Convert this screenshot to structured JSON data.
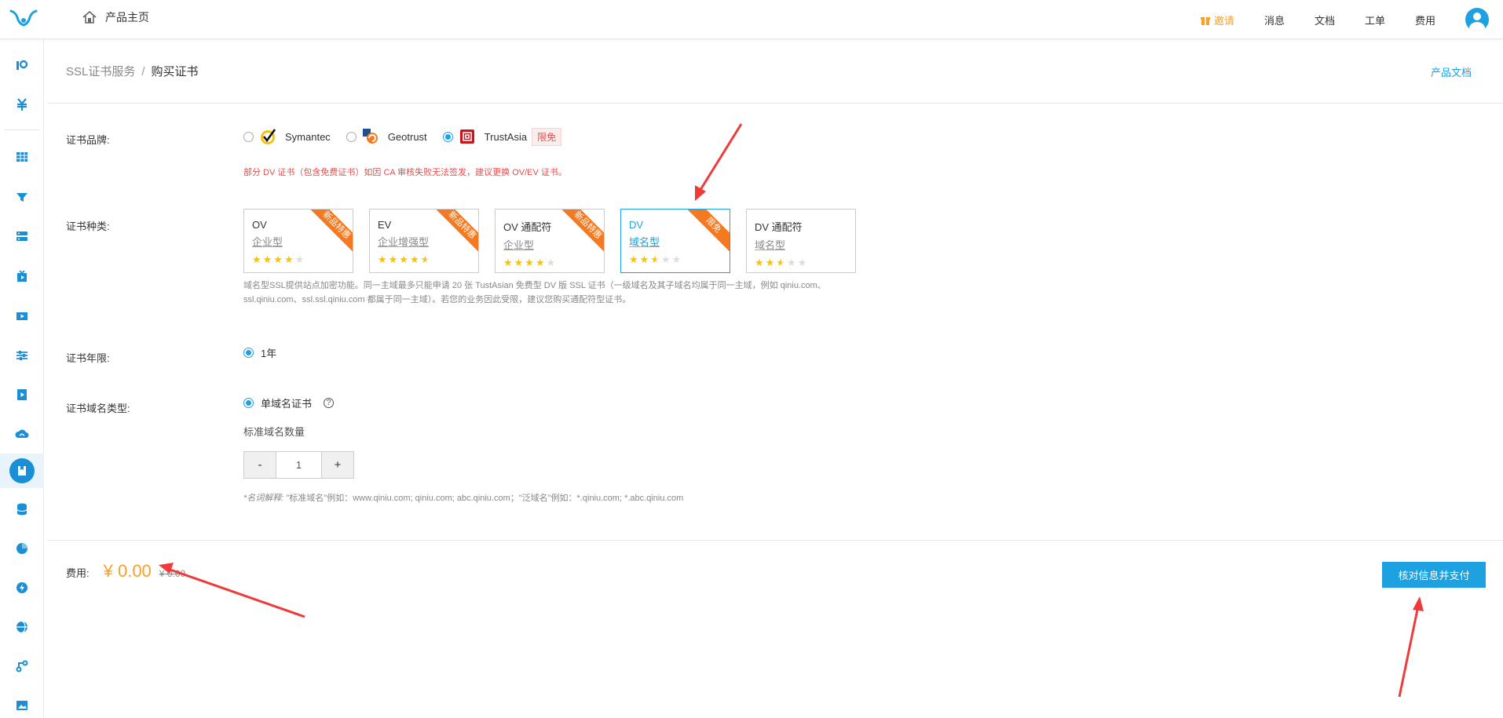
{
  "topbar": {
    "home_label": "产品主页",
    "invite": "邀请",
    "messages": "消息",
    "docs": "文档",
    "tickets": "工单",
    "billing": "费用"
  },
  "breadcrumb": {
    "service": "SSL证书服务",
    "separator": "/",
    "current": "购买证书"
  },
  "product_docs": "产品文档",
  "brand": {
    "label": "证书品牌:",
    "options": [
      {
        "name": "Symantec",
        "selected": false
      },
      {
        "name": "Geotrust",
        "selected": false
      },
      {
        "name": "TrustAsia",
        "selected": true,
        "tag": "限免"
      }
    ],
    "warning": "部分 DV 证书（包含免费证书）如因 CA 审核失败无法签发，建议更换 OV/EV 证书。"
  },
  "type": {
    "label": "证书种类:",
    "cards": [
      {
        "title": "OV",
        "subtitle": "企业型",
        "rating": 4,
        "ribbon": "新品特惠",
        "selected": false
      },
      {
        "title": "EV",
        "subtitle": "企业增强型",
        "rating": 4.5,
        "ribbon": "新品特惠",
        "selected": false
      },
      {
        "title": "OV 通配符",
        "subtitle": "企业型",
        "rating": 4,
        "ribbon": "新品特惠",
        "selected": false
      },
      {
        "title": "DV",
        "subtitle": "域名型",
        "rating": 2.5,
        "ribbon": "限免",
        "selected": true
      },
      {
        "title": "DV 通配符",
        "subtitle": "域名型",
        "rating": 2.5,
        "ribbon": "",
        "selected": false
      }
    ],
    "description_line1": "域名型SSL提供站点加密功能。同一主域最多只能申请 20 张 TustAsian 免费型 DV 版 SSL 证书（一级域名及其子域名均属于同一主域，例如 qiniu.com、",
    "description_line2": "ssl.qiniu.com、ssl.ssl.qiniu.com 都属于同一主域）。若您的业务因此受限，建议您购买通配符型证书。"
  },
  "period": {
    "label": "证书年限:",
    "option": "1年"
  },
  "domain_type": {
    "label": "证书域名类型:",
    "option": "单域名证书",
    "help": "?",
    "qty_label": "标准域名数量",
    "minus": "-",
    "value": "1",
    "plus": "+",
    "note_prefix": "*名词解释:",
    "note_body": " \"标准域名\"例如：www.qiniu.com; qiniu.com; abc.qiniu.com；\"泛域名\"例如：*.qiniu.com; *.abc.qiniu.com"
  },
  "fee": {
    "label": "费用:",
    "price": "¥ 0.00",
    "original": "¥ 0.00"
  },
  "pay_button": "核对信息并支付",
  "colors": {
    "accent": "#1ea1e0",
    "price": "#f7a128",
    "ribbon": "#f47920",
    "warning": "#e94d4d",
    "annotation_arrow": "#f03a3a"
  }
}
